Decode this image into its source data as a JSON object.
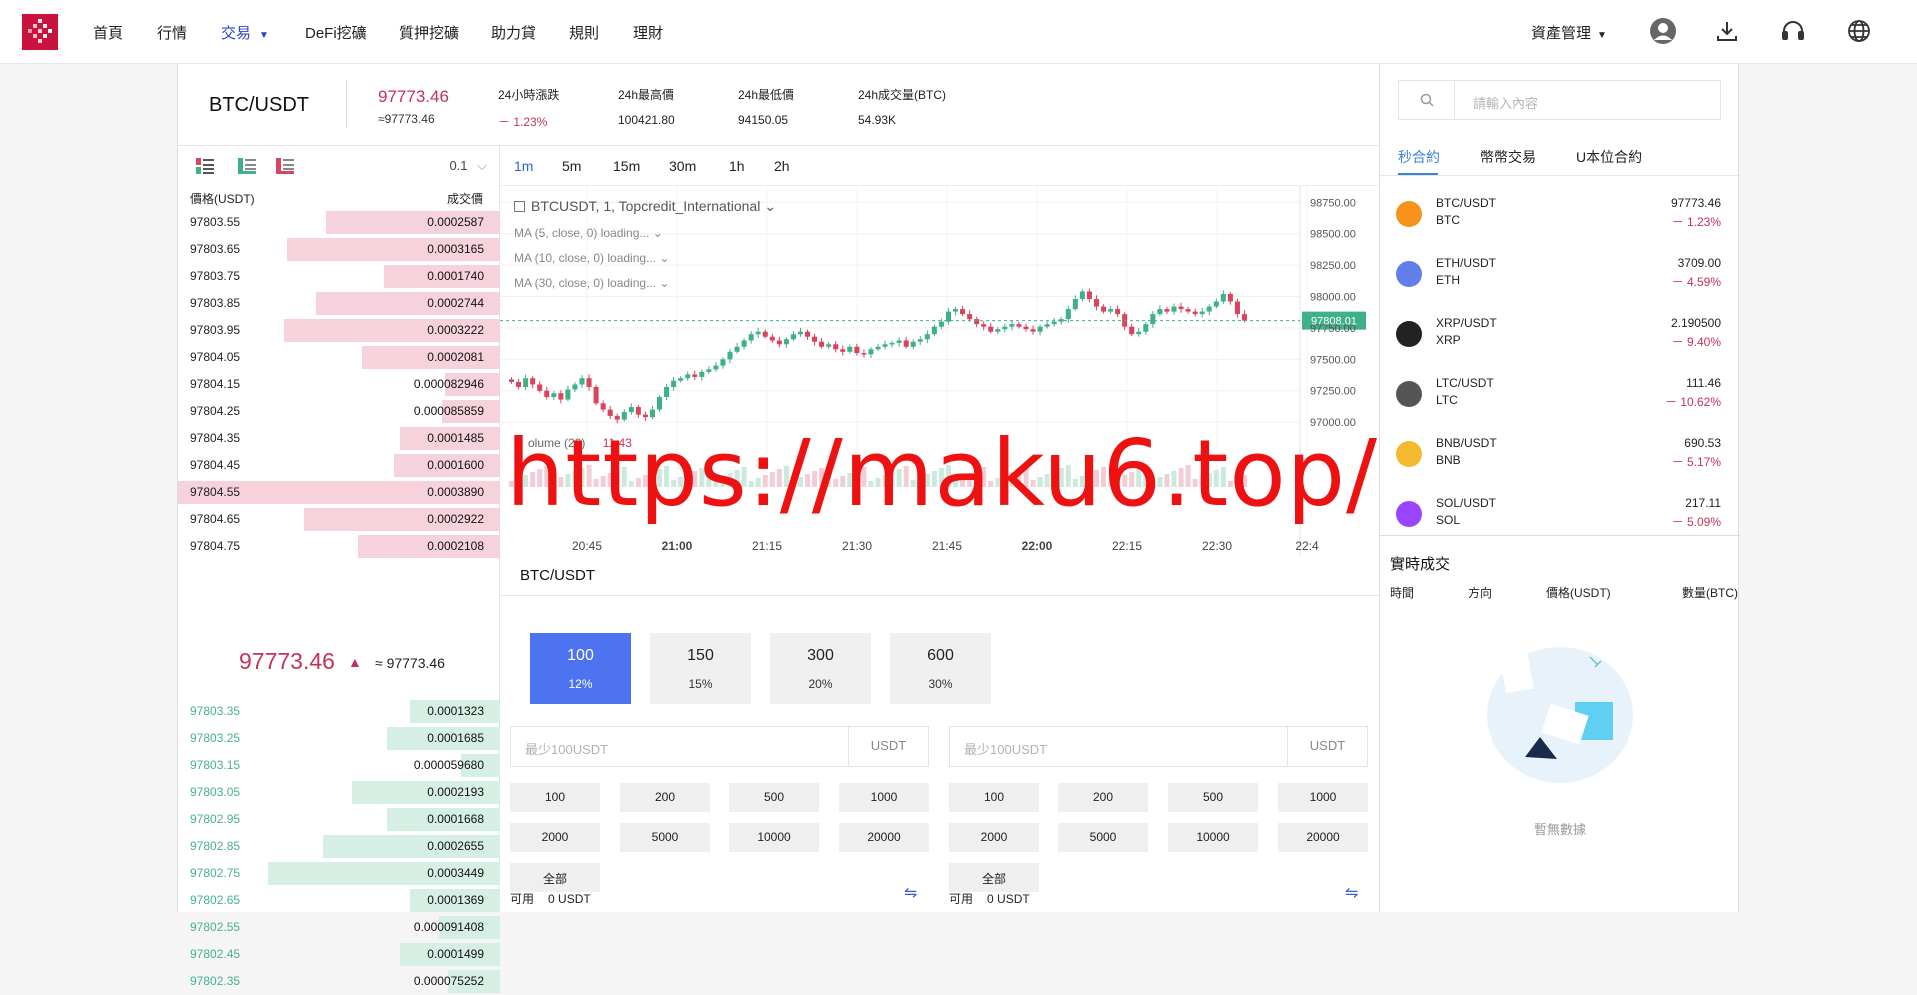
{
  "nav": {
    "items": [
      {
        "label": "首頁"
      },
      {
        "label": "行情"
      },
      {
        "label": "交易",
        "active": true
      },
      {
        "label": "DeFi挖礦"
      },
      {
        "label": "質押挖礦"
      },
      {
        "label": "助力貸"
      },
      {
        "label": "規則"
      },
      {
        "label": "理財"
      }
    ],
    "asset_mgmt": "資產管理",
    "icons": [
      "user-icon",
      "download-icon",
      "headset-icon",
      "globe-icon"
    ]
  },
  "ticker": {
    "pair": "BTC/USDT",
    "price": "97773.46",
    "price_sub": "≈97773.46",
    "stats": [
      {
        "label": "24小時漲跌",
        "value": "－ 1.23%"
      },
      {
        "label": "24h最高價",
        "value": "100421.80"
      },
      {
        "label": "24h最低價",
        "value": "94150.05"
      },
      {
        "label": "24h成交量(BTC)",
        "value": "54.93K"
      }
    ]
  },
  "orderbook": {
    "precision": "0.1",
    "col_price": "價格(USDT)",
    "col_qty": "成交價",
    "asks": [
      {
        "price": "97803.55",
        "qty": "0.0002587",
        "depth": 0.54
      },
      {
        "price": "97803.65",
        "qty": "0.0003165",
        "depth": 0.66
      },
      {
        "price": "97803.75",
        "qty": "0.0001740",
        "depth": 0.36
      },
      {
        "price": "97803.85",
        "qty": "0.0002744",
        "depth": 0.57
      },
      {
        "price": "97803.95",
        "qty": "0.0003222",
        "depth": 0.67
      },
      {
        "price": "97804.05",
        "qty": "0.0002081",
        "depth": 0.43
      },
      {
        "price": "97804.15",
        "qty": "0.000082946",
        "depth": 0.17
      },
      {
        "price": "97804.25",
        "qty": "0.000085859",
        "depth": 0.18
      },
      {
        "price": "97804.35",
        "qty": "0.0001485",
        "depth": 0.31
      },
      {
        "price": "97804.45",
        "qty": "0.0001600",
        "depth": 0.33
      },
      {
        "price": "97804.55",
        "qty": "0.0003890",
        "depth": 1.0
      },
      {
        "price": "97804.65",
        "qty": "0.0002922",
        "depth": 0.61
      },
      {
        "price": "97804.75",
        "qty": "0.0002108",
        "depth": 0.44
      }
    ],
    "mid_price": "97773.46",
    "mid_arrow": "▲",
    "mid_sub": "≈ 97773.46",
    "bids": [
      {
        "price": "97803.35",
        "qty": "0.0001323",
        "depth": 0.28
      },
      {
        "price": "97803.25",
        "qty": "0.0001685",
        "depth": 0.35
      },
      {
        "price": "97803.15",
        "qty": "0.000059680",
        "depth": 0.12
      },
      {
        "price": "97803.05",
        "qty": "0.0002193",
        "depth": 0.46
      },
      {
        "price": "97802.95",
        "qty": "0.0001668",
        "depth": 0.35
      },
      {
        "price": "97802.85",
        "qty": "0.0002655",
        "depth": 0.55
      },
      {
        "price": "97802.75",
        "qty": "0.0003449",
        "depth": 0.72
      },
      {
        "price": "97802.65",
        "qty": "0.0001369",
        "depth": 0.28
      },
      {
        "price": "97802.55",
        "qty": "0.000091408",
        "depth": 0.19
      },
      {
        "price": "97802.45",
        "qty": "0.0001499",
        "depth": 0.31
      },
      {
        "price": "97802.35",
        "qty": "0.000075252",
        "depth": 0.16
      }
    ]
  },
  "chart": {
    "intervals": [
      "1m",
      "5m",
      "15m",
      "30m",
      "1h",
      "2h"
    ],
    "active_interval": "1m",
    "symbol_line": "BTCUSDT, 1, Topcredit_International",
    "ma_lines": [
      "MA (5, close, 0) loading...",
      "MA (10, close, 0) loading...",
      "MA (30, close, 0) loading..."
    ],
    "volume_label": "olume (20)",
    "volume_value": "11.43",
    "last_price_tag": "97808.01",
    "y_ticks": [
      "98750.00",
      "98500.00",
      "98250.00",
      "98000.00",
      "97750.00",
      "97500.00",
      "97250.00",
      "97000.00"
    ],
    "x_ticks": [
      "20:45",
      "21:00",
      "21:15",
      "21:30",
      "21:45",
      "22:00",
      "22:15",
      "22:30",
      "22:4"
    ],
    "watermark": "https://maku6.top/"
  },
  "chart_data": {
    "type": "candlestick",
    "symbol": "BTCUSDT",
    "interval": "1m",
    "ylim": [
      96850,
      98800
    ],
    "last_price": 97808.01,
    "closes": [
      97320,
      97280,
      97350,
      97300,
      97250,
      97200,
      97230,
      97180,
      97260,
      97300,
      97350,
      97280,
      97150,
      97100,
      97050,
      97020,
      97080,
      97120,
      97060,
      97040,
      97100,
      97200,
      97280,
      97330,
      97350,
      97380,
      97360,
      97400,
      97420,
      97450,
      97500,
      97560,
      97600,
      97650,
      97700,
      97720,
      97680,
      97650,
      97620,
      97660,
      97700,
      97720,
      97680,
      97640,
      97600,
      97620,
      97580,
      97560,
      97600,
      97550,
      97540,
      97580,
      97600,
      97620,
      97630,
      97650,
      97600,
      97640,
      97660,
      97700,
      97760,
      97800,
      97880,
      97900,
      97860,
      97820,
      97780,
      97760,
      97720,
      97740,
      97760,
      97780,
      97760,
      97740,
      97720,
      97760,
      97780,
      97800,
      97820,
      97900,
      97980,
      98040,
      97980,
      97920,
      97880,
      97900,
      97860,
      97760,
      97700,
      97720,
      97780,
      97860,
      97900,
      97880,
      97920,
      97900,
      97880,
      97860,
      97880,
      97920,
      97960,
      98020,
      97960,
      97860,
      97808
    ]
  },
  "trade": {
    "title": "BTC/USDT",
    "periods": [
      {
        "time": "100",
        "rate": "12%"
      },
      {
        "time": "150",
        "rate": "15%"
      },
      {
        "time": "300",
        "rate": "20%"
      },
      {
        "time": "600",
        "rate": "30%"
      }
    ],
    "placeholder": "最少100USDT",
    "unit": "USDT",
    "quick": [
      "100",
      "200",
      "500",
      "1000",
      "2000",
      "5000",
      "10000",
      "20000"
    ],
    "all_label": "全部",
    "avail_label": "可用",
    "avail_value": "0 USDT",
    "swap_icon": "⇋"
  },
  "right": {
    "search_placeholder": "請輸入內容",
    "tabs": [
      "秒合約",
      "幣幣交易",
      "U本位合約"
    ],
    "markets": [
      {
        "pair": "BTC/USDT",
        "base": "BTC",
        "price": "97773.46",
        "change": "－ 1.23%",
        "icon": "bitcoin-icon",
        "color": "#f7931a"
      },
      {
        "pair": "ETH/USDT",
        "base": "ETH",
        "price": "3709.00",
        "change": "－ 4.59%",
        "icon": "ethereum-icon",
        "color": "#627eea"
      },
      {
        "pair": "XRP/USDT",
        "base": "XRP",
        "price": "2.190500",
        "change": "－ 9.40%",
        "icon": "xrp-icon",
        "color": "#222222"
      },
      {
        "pair": "LTC/USDT",
        "base": "LTC",
        "price": "111.46",
        "change": "－ 10.62%",
        "icon": "litecoin-icon",
        "color": "#555555"
      },
      {
        "pair": "BNB/USDT",
        "base": "BNB",
        "price": "690.53",
        "change": "－ 5.17%",
        "icon": "bnb-icon",
        "color": "#f3ba2f"
      },
      {
        "pair": "SOL/USDT",
        "base": "SOL",
        "price": "217.11",
        "change": "－ 5.09%",
        "icon": "solana-icon",
        "color": "#9945ff"
      }
    ],
    "realtime_title": "實時成交",
    "realtime_cols": [
      "時間",
      "方向",
      "價格(USDT)",
      "數量(BTC)"
    ],
    "empty_text": "暫無數據"
  },
  "colors": {
    "accent": "#4e73f0",
    "down": "#c43357",
    "up": "#3fb088",
    "brand": "#c8133f"
  }
}
